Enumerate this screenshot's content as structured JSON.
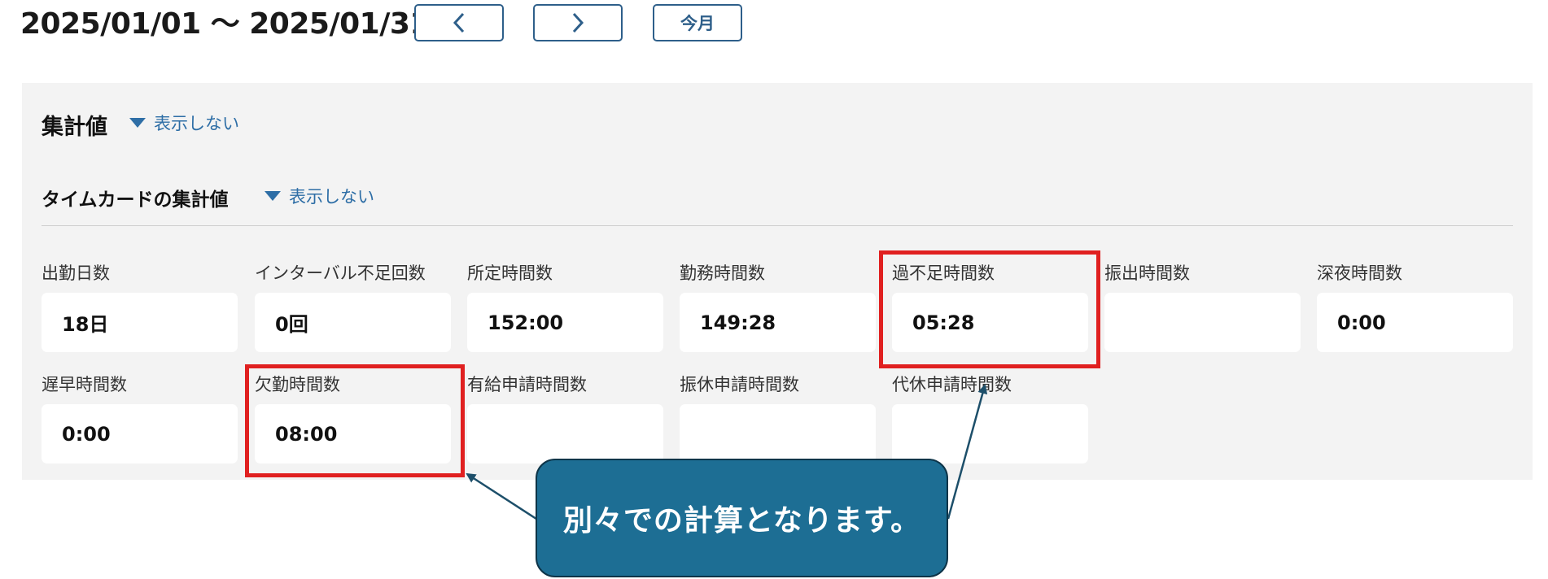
{
  "header": {
    "date_range": "2025/01/01 〜 2025/01/31",
    "prev_icon": "chevron-left-icon",
    "next_icon": "chevron-right-icon",
    "today_label": "今月",
    "button_color": "#2e5f8a"
  },
  "summary": {
    "title": "集計値",
    "toggle_label": "表示しない"
  },
  "timecard": {
    "title": "タイムカードの集計値",
    "toggle_label": "表示しない",
    "fields": [
      {
        "label": "出勤日数",
        "value": "18日"
      },
      {
        "label": "インターバル不足回数",
        "value": "0回"
      },
      {
        "label": "所定時間数",
        "value": "152:00"
      },
      {
        "label": "勤務時間数",
        "value": "149:28"
      },
      {
        "label": "過不足時間数",
        "value": "05:28"
      },
      {
        "label": "振出時間数",
        "value": ""
      },
      {
        "label": "深夜時間数",
        "value": "0:00"
      },
      {
        "label": "遅早時間数",
        "value": "0:00"
      },
      {
        "label": "欠勤時間数",
        "value": "08:00"
      },
      {
        "label": "有給申請時間数",
        "value": ""
      },
      {
        "label": "振休申請時間数",
        "value": ""
      },
      {
        "label": "代休申請時間数",
        "value": ""
      }
    ]
  },
  "annotation": {
    "callout_text": "別々での計算となります。",
    "highlight_color": "#e02020",
    "callout_color": "#1d6e94"
  }
}
